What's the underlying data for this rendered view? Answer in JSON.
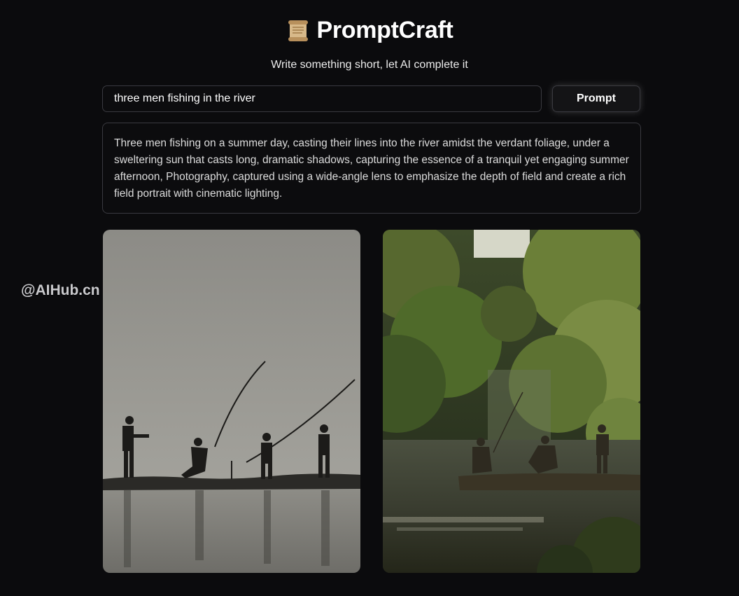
{
  "app": {
    "title": "PromptCraft",
    "title_icon": "scroll-icon",
    "subtitle": "Write something short, let AI complete it"
  },
  "prompt": {
    "input_value": "three men fishing in the river",
    "button_label": "Prompt"
  },
  "result": {
    "text": "Three men fishing on a summer day, casting their lines into the river amidst the verdant foliage, under a sweltering sun that casts long, dramatic shadows, capturing the essence of a tranquil yet engaging summer afternoon, Photography, captured using a wide-angle lens to emphasize the depth of field and create a rich field portrait with cinematic lighting."
  },
  "watermark": "@AIHub.cn",
  "images": [
    {
      "name": "generated-image-silhouette",
      "description_hidden": true
    },
    {
      "name": "generated-image-forest-river",
      "description_hidden": true
    }
  ],
  "colors": {
    "background": "#0b0b0d",
    "border": "#3a3a40",
    "text": "#ffffff"
  }
}
